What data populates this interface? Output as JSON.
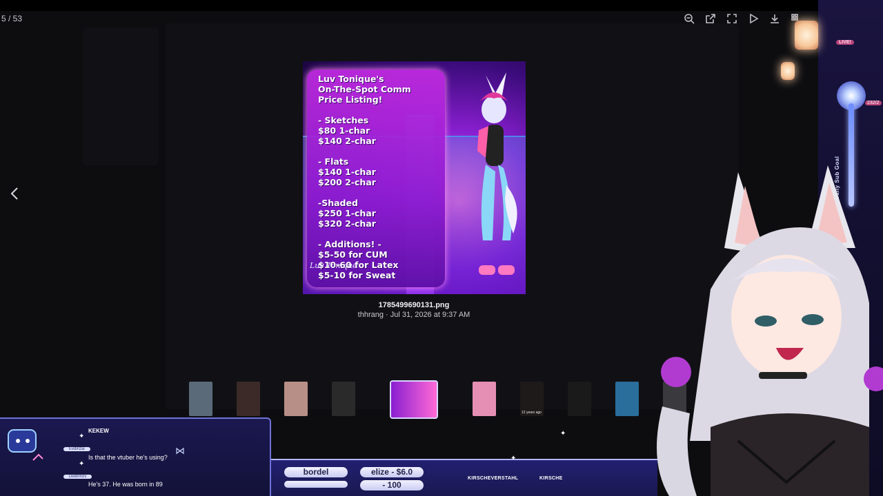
{
  "viewer": {
    "counter": "5 / 53",
    "toolbar": {
      "zoom_out": "zoom-out-icon",
      "open_external": "external-link-icon",
      "fullscreen": "fullscreen-icon",
      "slideshow": "play-icon",
      "download": "download-icon",
      "grid": "grid-icon"
    },
    "prev": "chevron-left-icon"
  },
  "image": {
    "title": "Luv Tonique's",
    "line2": "On-The-Spot Comm",
    "line3": "Price Listing!",
    "sketches": "- Sketches",
    "sketch1": "$80 1-char",
    "sketch2": "$140 2-char",
    "flats": "- Flats",
    "flat1": "$140 1-char",
    "flat2": "$200 2-char",
    "shaded": "-Shaded",
    "shade1": "$250 1-char",
    "shade2": "$320 2-char",
    "additions": "- Additions! -",
    "add1": "$5-50 for CUM",
    "add2": "$10-60 for Latex",
    "add3": "$5-10 for Sweat",
    "signature": "Luv Tonique"
  },
  "caption": {
    "filename": "1785499690131.png",
    "meta": "thhrang · Jul 31, 2026 at 9:37 AM"
  },
  "thumbnails": [
    {
      "label": "",
      "color": "#5a6a78"
    },
    {
      "label": "",
      "color": "#3b2a28"
    },
    {
      "label": "",
      "color": "#b88f86"
    },
    {
      "label": "",
      "color": "#2a2a2a"
    },
    {
      "label": "",
      "color": "#7a2fd1"
    },
    {
      "label": "",
      "color": "#e58fb4"
    },
    {
      "label": "12 years ago",
      "color": "#1d1a19"
    },
    {
      "label": "",
      "color": "#1a1a1a"
    },
    {
      "label": "",
      "color": "#2a6e9c"
    },
    {
      "label": "",
      "color": "#3a3a3e"
    }
  ],
  "stream": {
    "live": "LIVE!",
    "goal_label": "Daily Sub Goal",
    "goal_count": "232/2"
  },
  "chat": {
    "partial_top": "KEKEW",
    "messages": [
      {
        "user": "Evdinzai",
        "text": "Is that the vtuber he's using?"
      },
      {
        "user": "Deldrinov",
        "text": "He's 37. He was born in 89"
      }
    ]
  },
  "bottom_bar": {
    "pill1": "bordel",
    "pill2": "elize - $6.0",
    "pill3": "- 100",
    "social1": "KIRSCHEVERSTAHL",
    "social2": "KIRSCHE"
  }
}
